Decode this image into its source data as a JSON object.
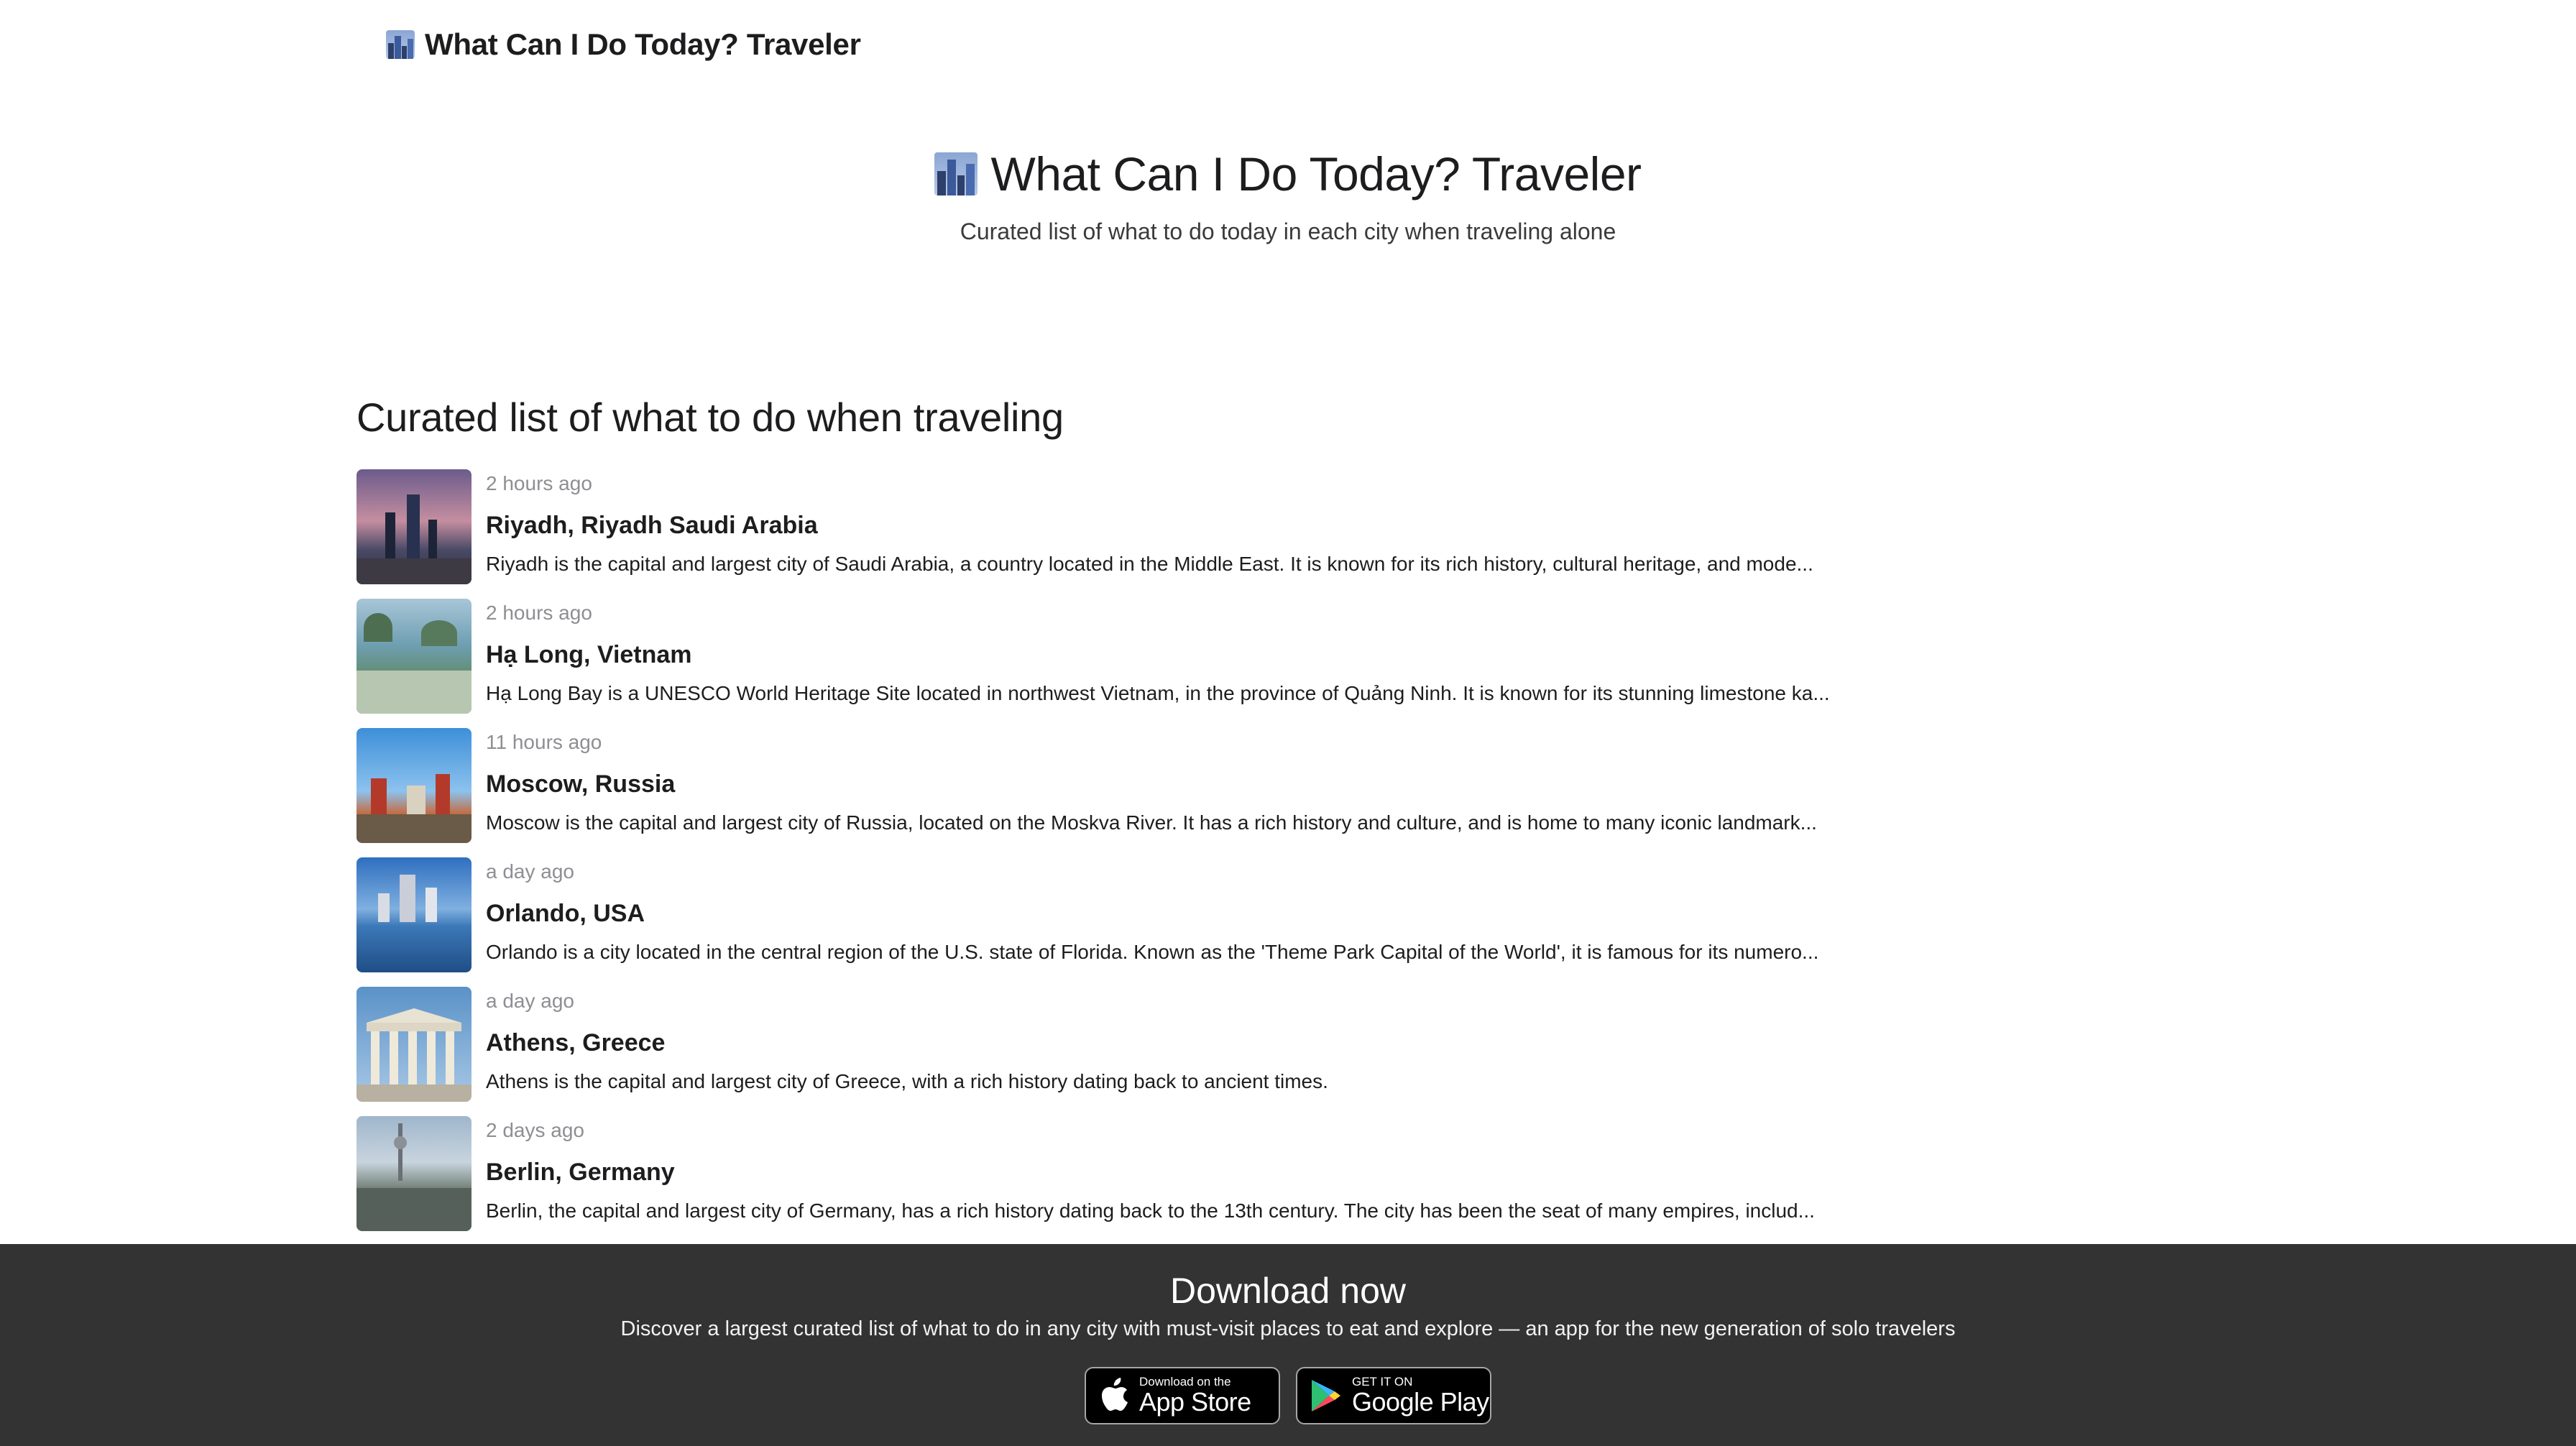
{
  "nav": {
    "brand": "What Can I Do Today? Traveler",
    "logo_icon": "cityscape-icon"
  },
  "hero": {
    "title": "What Can I Do Today? Traveler",
    "subtitle": "Curated list of what to do today in each city when traveling alone",
    "icon": "cityscape-icon"
  },
  "section": {
    "title": "Curated list of what to do when traveling"
  },
  "items": [
    {
      "time": "2 hours ago",
      "name": "Riyadh, Riyadh Saudi Arabia",
      "desc": "Riyadh is the capital and largest city of Saudi Arabia, a country located in the Middle East. It is known for its rich history, cultural heritage, and mode...",
      "thumb": "riyadh-skyline-photo"
    },
    {
      "time": "2 hours ago",
      "name": "Hạ Long, Vietnam",
      "desc": "Hạ Long Bay is a UNESCO World Heritage Site located in northwest Vietnam, in the province of Quảng Ninh. It is known for its stunning limestone ka...",
      "thumb": "ha-long-bay-photo"
    },
    {
      "time": "11 hours ago",
      "name": "Moscow, Russia",
      "desc": "Moscow is the capital and largest city of Russia, located on the Moskva River. It has a rich history and culture, and is home to many iconic landmark...",
      "thumb": "moscow-kremlin-photo"
    },
    {
      "time": "a day ago",
      "name": "Orlando, USA",
      "desc": "Orlando is a city located in the central region of the U.S. state of Florida. Known as the 'Theme Park Capital of the World', it is famous for its numero...",
      "thumb": "orlando-lake-photo"
    },
    {
      "time": "a day ago",
      "name": "Athens, Greece",
      "desc": "Athens is the capital and largest city of Greece, with a rich history dating back to ancient times.",
      "thumb": "athens-columns-photo"
    },
    {
      "time": "2 days ago",
      "name": "Berlin, Germany",
      "desc": "Berlin, the capital and largest city of Germany, has a rich history dating back to the 13th century. The city has been the seat of many empires, includ...",
      "thumb": "berlin-tv-tower-photo"
    }
  ],
  "footer": {
    "title": "Download now",
    "subtitle": "Discover a largest curated list of what to do in any city with must-visit places to eat and explore — an app for the new generation of solo travelers",
    "app_store": {
      "small": "Download on the",
      "big": "App Store"
    },
    "google_play": {
      "small": "GET IT ON",
      "big": "Google Play"
    }
  },
  "colors": {
    "footer_bg": "#333333",
    "muted_text": "#8e8e93",
    "text": "#1d1d1f"
  }
}
